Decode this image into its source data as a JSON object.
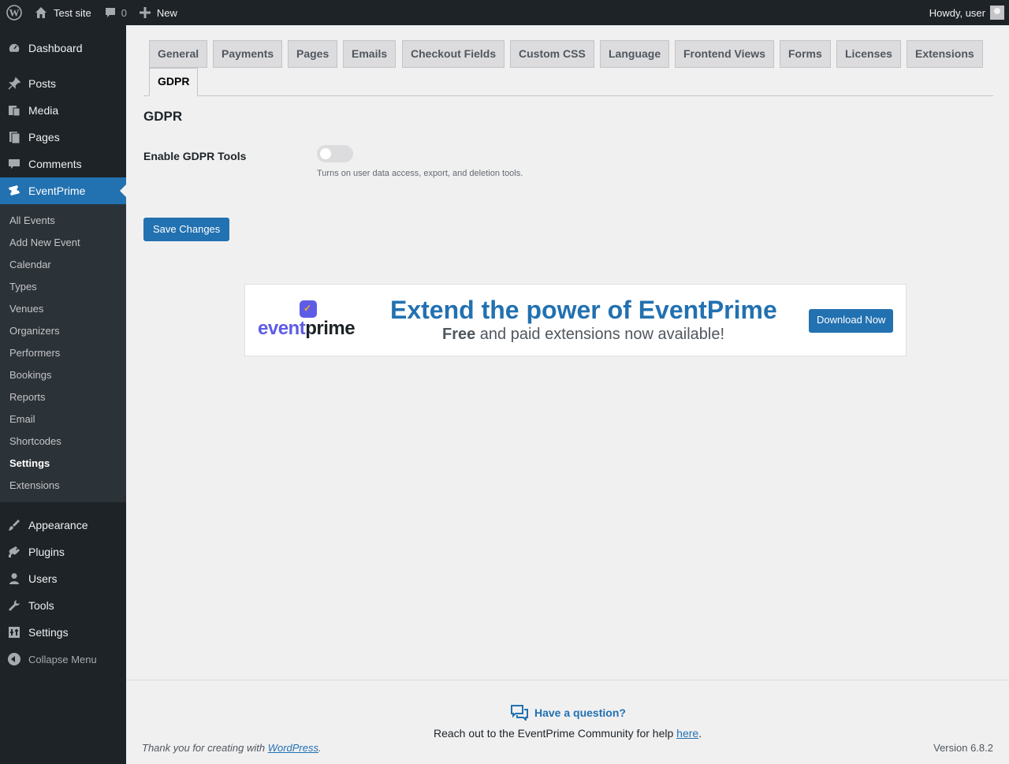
{
  "admin_bar": {
    "site_name": "Test site",
    "comments_count": "0",
    "new_label": "New",
    "greeting": "Howdy, user"
  },
  "sidebar": {
    "top_items": [
      {
        "label": "Dashboard",
        "icon": "dashboard-icon"
      },
      {
        "label": "Posts",
        "icon": "pin-icon"
      },
      {
        "label": "Media",
        "icon": "media-icon"
      },
      {
        "label": "Pages",
        "icon": "pages-icon"
      },
      {
        "label": "Comments",
        "icon": "comment-icon"
      },
      {
        "label": "EventPrime",
        "icon": "ticket-icon"
      }
    ],
    "submenu": [
      "All Events",
      "Add New Event",
      "Calendar",
      "Types",
      "Venues",
      "Organizers",
      "Performers",
      "Bookings",
      "Reports",
      "Email",
      "Shortcodes",
      "Settings",
      "Extensions"
    ],
    "bottom_items": [
      {
        "label": "Appearance",
        "icon": "brush-icon"
      },
      {
        "label": "Plugins",
        "icon": "plug-icon"
      },
      {
        "label": "Users",
        "icon": "user-icon"
      },
      {
        "label": "Tools",
        "icon": "wrench-icon"
      },
      {
        "label": "Settings",
        "icon": "settings-icon"
      }
    ],
    "collapse_label": "Collapse Menu"
  },
  "tabs": [
    "General",
    "Payments",
    "Pages",
    "Emails",
    "Checkout Fields",
    "Custom CSS",
    "Language",
    "Frontend Views",
    "Forms",
    "Licenses",
    "Extensions",
    "GDPR"
  ],
  "active_tab": "GDPR",
  "section": {
    "title": "GDPR",
    "field_label": "Enable GDPR Tools",
    "field_enabled": false,
    "field_description": "Turns on user data access, export, and deletion tools.",
    "save_label": "Save Changes"
  },
  "banner": {
    "logo_text_1": "event",
    "logo_text_2": "prime",
    "headline": "Extend the power of EventPrime",
    "sub_bold": "Free",
    "sub_rest": " and paid extensions now available!",
    "button_label": "Download Now"
  },
  "footer": {
    "question": "Have a question?",
    "community_text": "Reach out to the EventPrime Community for help ",
    "community_link": "here",
    "community_end": ".",
    "thanks_text": "Thank you for creating with ",
    "thanks_link": "WordPress",
    "thanks_end": ".",
    "version": "Version 6.8.2"
  },
  "colors": {
    "accent": "#2271b1",
    "sidebar_bg": "#1d2327",
    "submenu_bg": "#2c3338",
    "brand_purple": "#5e5ce6"
  }
}
